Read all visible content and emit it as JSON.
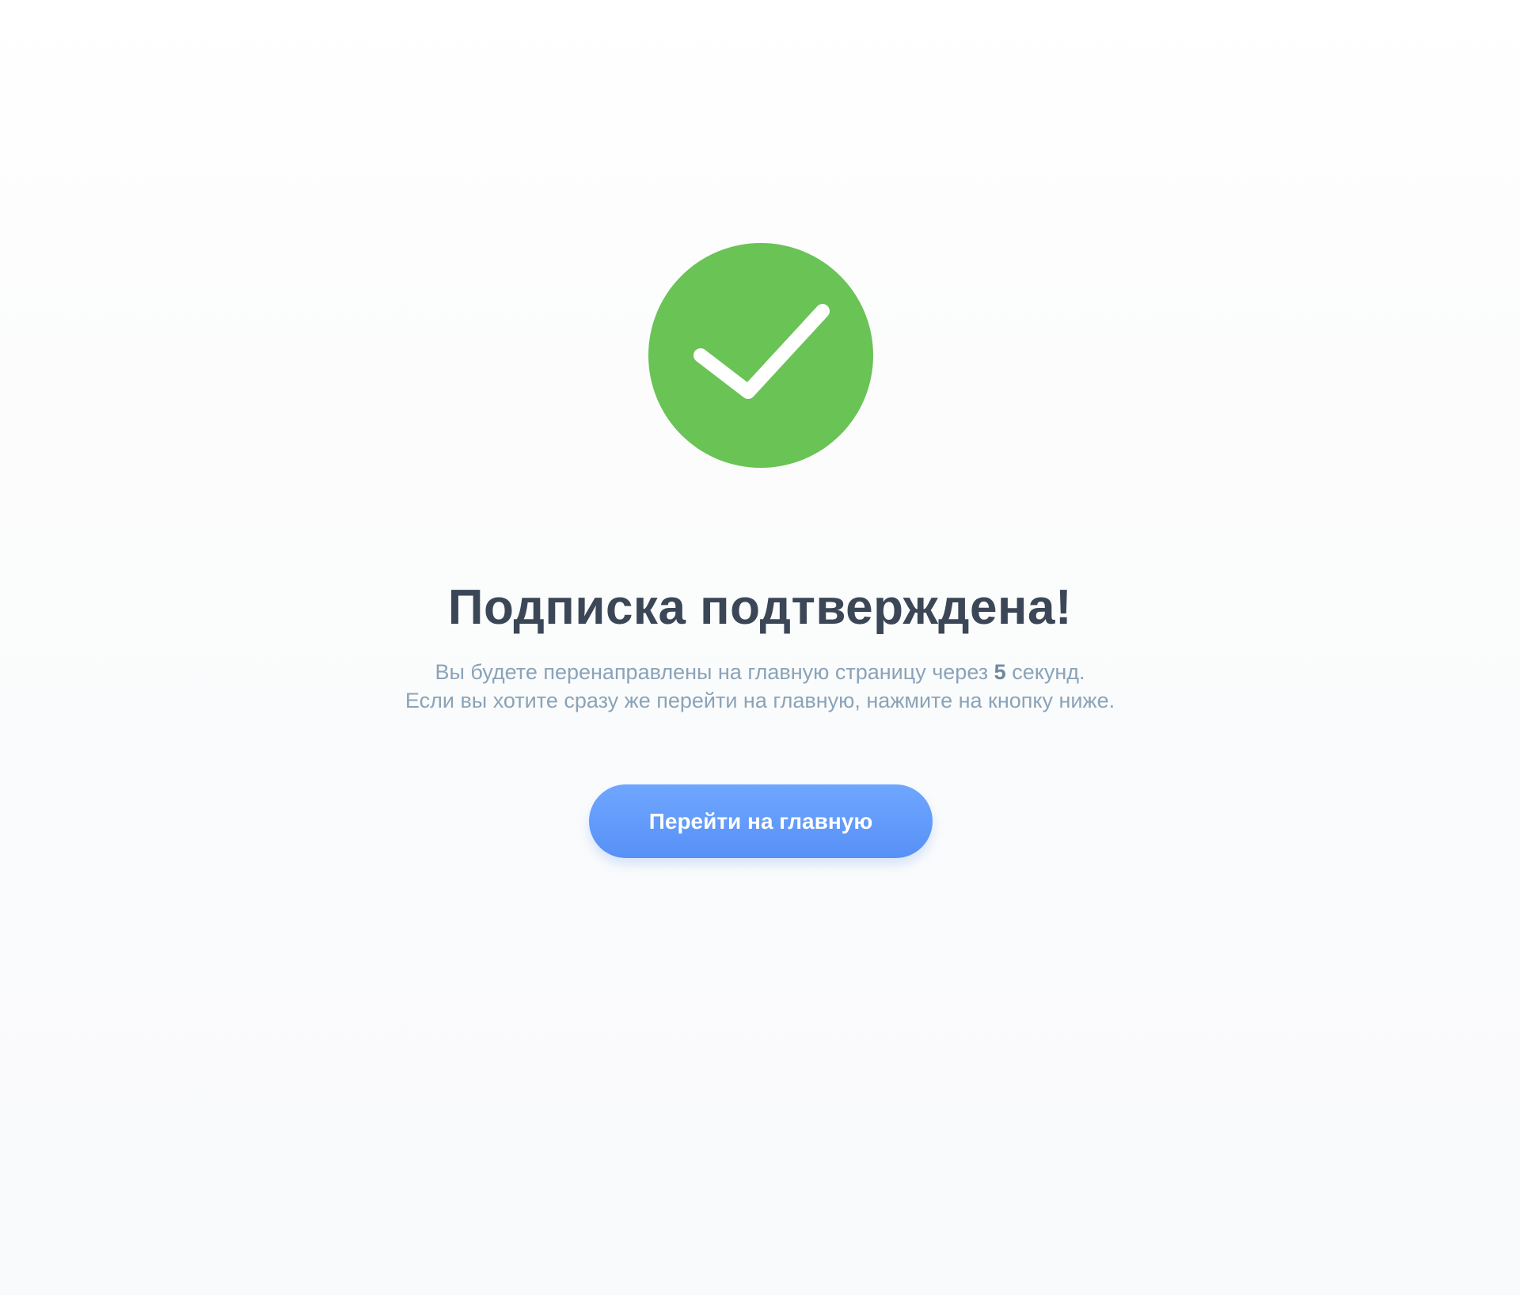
{
  "status": {
    "icon": "checkmark-circle-icon",
    "color": "#69c355"
  },
  "title": "Подписка подтверждена!",
  "message": {
    "line1_before": "Вы будете перенаправлены на главную страницу через",
    "countdown": "5",
    "line1_after": "секунд.",
    "line2": "Если вы хотите сразу же перейти на главную, нажмите на кнопку ниже."
  },
  "button": {
    "label": "Перейти на главную",
    "color": "#5891f6"
  },
  "colors": {
    "title": "#3b4656",
    "message": "#8aa3b8"
  }
}
